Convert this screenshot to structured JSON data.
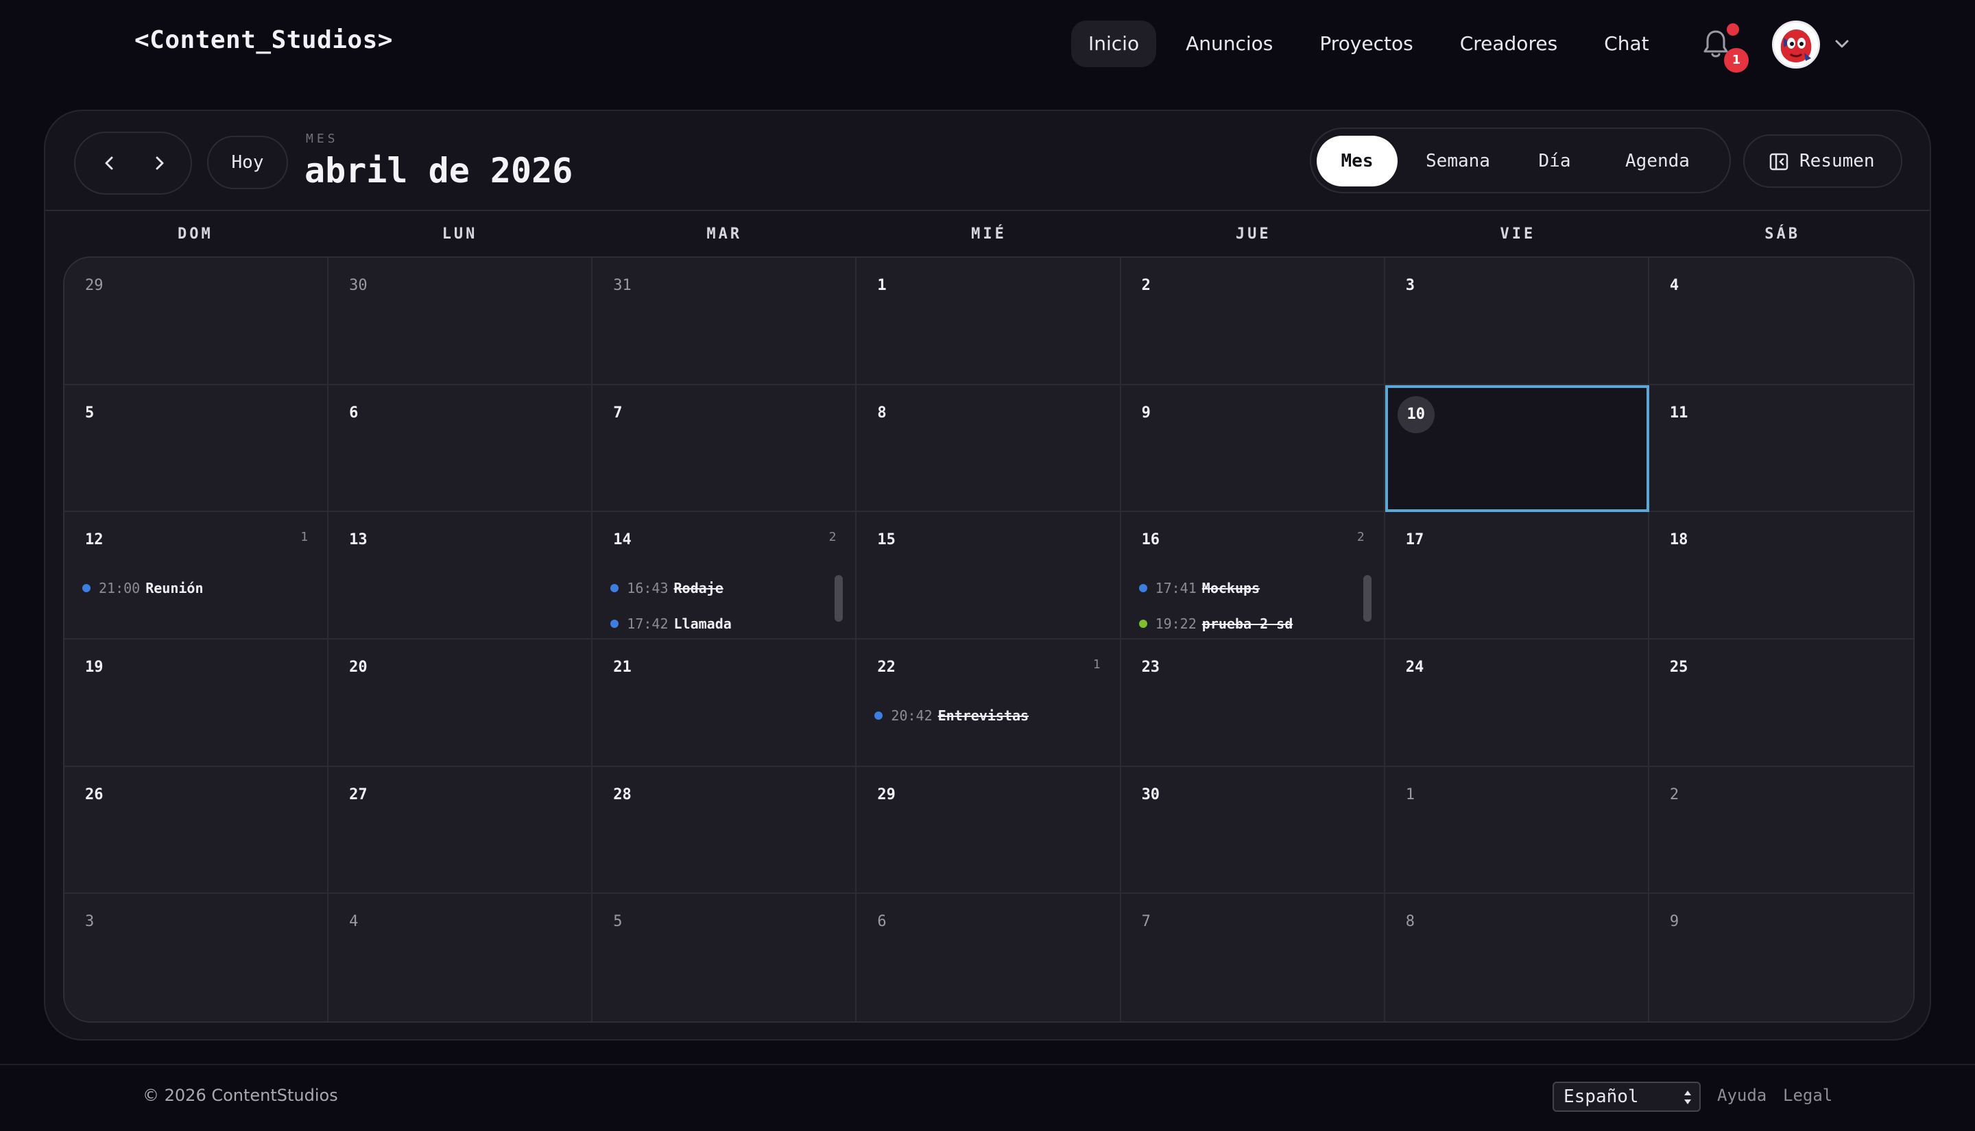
{
  "app": {
    "logo": "<Content_Studios>"
  },
  "nav": {
    "items": [
      {
        "label": "Inicio",
        "active": true
      },
      {
        "label": "Anuncios",
        "active": false
      },
      {
        "label": "Proyectos",
        "active": false
      },
      {
        "label": "Creadores",
        "active": false
      },
      {
        "label": "Chat",
        "active": false
      }
    ],
    "notifications_count": "1",
    "icons": {
      "bell": "bell-icon",
      "avatar": "avatar-image",
      "caret": "chevron-down-icon"
    }
  },
  "calendar": {
    "today_label": "Hoy",
    "period_caption": "MES",
    "title": "abril de 2026",
    "views": [
      {
        "label": "Mes",
        "active": true
      },
      {
        "label": "Semana",
        "active": false
      },
      {
        "label": "Día",
        "active": false
      },
      {
        "label": "Agenda",
        "active": false
      }
    ],
    "summary_label": "Resumen",
    "weekdays": [
      "DOM",
      "LUN",
      "MAR",
      "MIÉ",
      "JUE",
      "VIE",
      "SÁB"
    ],
    "event_colors": {
      "blue": "#3d7fe0",
      "green": "#7fbf2e"
    },
    "today_highlight": "#5ba7d6",
    "weeks": [
      [
        {
          "day": "29",
          "other": true
        },
        {
          "day": "30",
          "other": true
        },
        {
          "day": "31",
          "other": true
        },
        {
          "day": "1"
        },
        {
          "day": "2"
        },
        {
          "day": "3"
        },
        {
          "day": "4"
        }
      ],
      [
        {
          "day": "5"
        },
        {
          "day": "6"
        },
        {
          "day": "7"
        },
        {
          "day": "8"
        },
        {
          "day": "9"
        },
        {
          "day": "10",
          "today": true
        },
        {
          "day": "11"
        }
      ],
      [
        {
          "day": "12",
          "count": "1",
          "events": [
            {
              "time": "21:00",
              "title": "Reunión",
              "color": "blue",
              "done": false
            }
          ]
        },
        {
          "day": "13"
        },
        {
          "day": "14",
          "count": "2",
          "scroll": true,
          "events": [
            {
              "time": "16:43",
              "title": "Rodaje",
              "color": "blue",
              "done": true
            },
            {
              "time": "17:42",
              "title": "Llamada",
              "color": "blue",
              "done": false
            }
          ]
        },
        {
          "day": "15"
        },
        {
          "day": "16",
          "count": "2",
          "scroll": true,
          "events": [
            {
              "time": "17:41",
              "title": "Mockups",
              "color": "blue",
              "done": true
            },
            {
              "time": "19:22",
              "title": "prueba 2 sd",
              "color": "green",
              "done": true
            }
          ]
        },
        {
          "day": "17"
        },
        {
          "day": "18"
        }
      ],
      [
        {
          "day": "19"
        },
        {
          "day": "20"
        },
        {
          "day": "21"
        },
        {
          "day": "22",
          "count": "1",
          "events": [
            {
              "time": "20:42",
              "title": "Entrevistas",
              "color": "blue",
              "done": true
            }
          ]
        },
        {
          "day": "23"
        },
        {
          "day": "24"
        },
        {
          "day": "25"
        }
      ],
      [
        {
          "day": "26"
        },
        {
          "day": "27"
        },
        {
          "day": "28"
        },
        {
          "day": "29"
        },
        {
          "day": "30"
        },
        {
          "day": "1",
          "other": true
        },
        {
          "day": "2",
          "other": true
        }
      ],
      [
        {
          "day": "3",
          "other": true
        },
        {
          "day": "4",
          "other": true
        },
        {
          "day": "5",
          "other": true
        },
        {
          "day": "6",
          "other": true
        },
        {
          "day": "7",
          "other": true
        },
        {
          "day": "8",
          "other": true
        },
        {
          "day": "9",
          "other": true
        }
      ]
    ]
  },
  "footer": {
    "copyright": "© 2026 ContentStudios",
    "language": "Español",
    "links": [
      "Ayuda",
      "Legal"
    ]
  }
}
